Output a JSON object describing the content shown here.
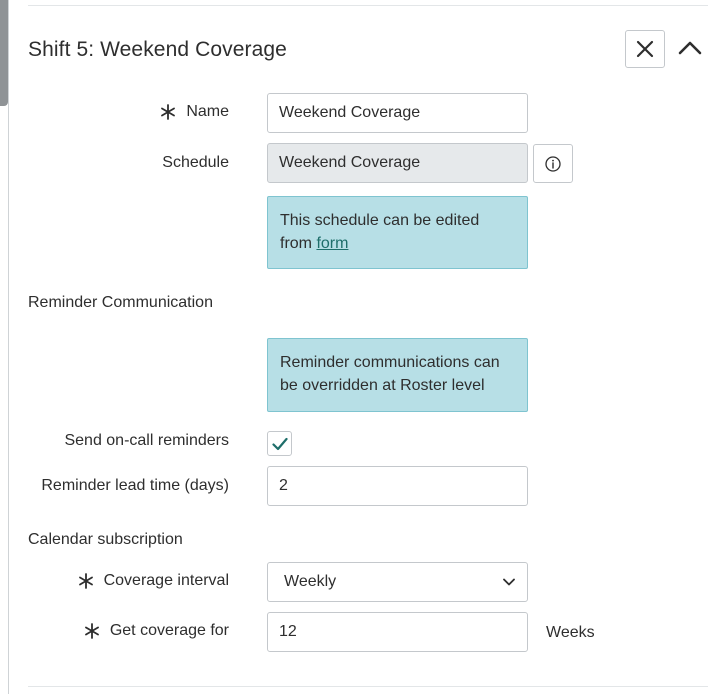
{
  "header": {
    "title": "Shift 5: Weekend Coverage",
    "close_icon": "close-icon",
    "collapse_icon": "chevron-up-icon"
  },
  "fields": {
    "name": {
      "label": "Name",
      "value": "Weekend Coverage",
      "required": true
    },
    "schedule": {
      "label": "Schedule",
      "value": "Weekend Coverage",
      "info_icon": "info-icon"
    },
    "schedule_note": {
      "text": "This schedule can be edited from ",
      "link": "form"
    }
  },
  "reminder": {
    "section_label": "Reminder Communication",
    "note": "Reminder communications can be overridden at Roster level",
    "send_label": "Send on-call reminders",
    "send_checked": true,
    "lead_label": "Reminder lead time (days)",
    "lead_value": "2"
  },
  "calendar": {
    "section_label": "Calendar subscription",
    "interval_label": "Coverage interval",
    "interval_value": "Weekly",
    "coverage_label": "Get coverage for",
    "coverage_value": "12",
    "coverage_unit": "Weeks"
  },
  "colors": {
    "note_bg": "#b7dfe6",
    "link": "#1e6e6a",
    "check": "#1e6e6a"
  }
}
